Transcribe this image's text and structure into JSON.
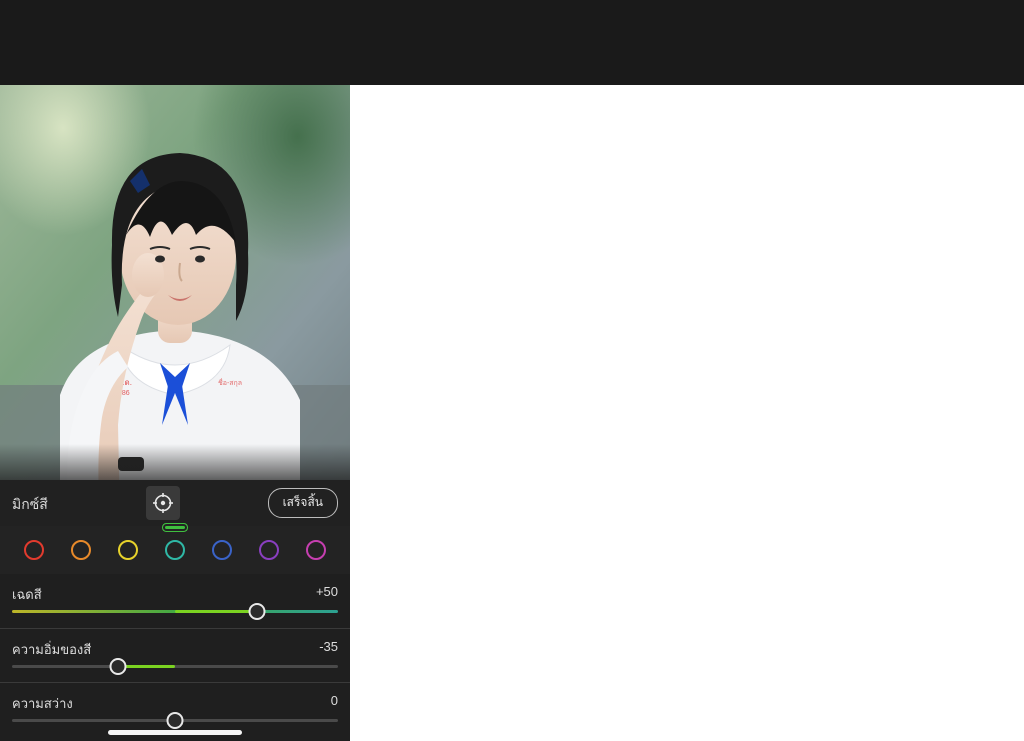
{
  "top_bar": {},
  "mix": {
    "panel_label": "มิกซ์สี",
    "done_label": "เสร็จสิ้น"
  },
  "swatches": [
    {
      "name": "red",
      "color": "#e23b2e",
      "selected": false
    },
    {
      "name": "orange",
      "color": "#e88a2a",
      "selected": false
    },
    {
      "name": "yellow",
      "color": "#e7d22b",
      "selected": false
    },
    {
      "name": "green",
      "color": "#3fbf3f",
      "selected": true
    },
    {
      "name": "aqua",
      "color": "#2fb8a6",
      "selected": false
    },
    {
      "name": "blue",
      "color": "#3a63c8",
      "selected": false
    },
    {
      "name": "purple",
      "color": "#8a3fc0",
      "selected": false
    },
    {
      "name": "magenta",
      "color": "#c63fb0",
      "selected": false
    }
  ],
  "sliders": {
    "hue": {
      "label": "เฉดสี",
      "value": "+50",
      "pos": 0.75,
      "gradient": true,
      "fill_from": 0.5,
      "fill_to": 0.75
    },
    "saturation": {
      "label": "ความอิ่มของสี",
      "value": "-35",
      "pos": 0.325,
      "gradient": false,
      "fill_from": 0.325,
      "fill_to": 0.5
    },
    "luminance": {
      "label": "ความสว่าง",
      "value": "0",
      "pos": 0.5,
      "gradient": false,
      "fill_from": 0.5,
      "fill_to": 0.5
    }
  }
}
